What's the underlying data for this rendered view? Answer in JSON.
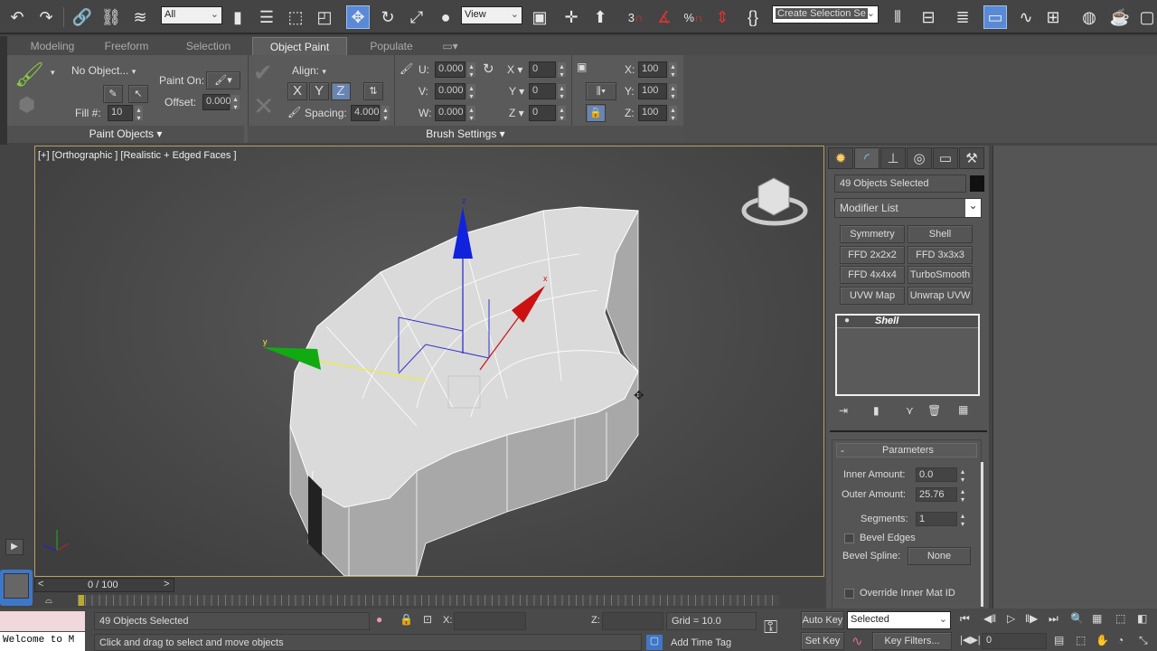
{
  "toolbar": {
    "selection_filter": "All",
    "reference_coord": "View",
    "named_selection_placeholder": "Create Selection Se",
    "snap_angle_label": "3",
    "percent_snap_label": "%"
  },
  "ribbon": {
    "tabs": [
      "Modeling",
      "Freeform",
      "Selection",
      "Object Paint",
      "Populate"
    ],
    "active_tab": "Object Paint",
    "paint_objects": {
      "object_dropdown": "No Object...",
      "fill_label": "Fill #:",
      "fill_value": "10",
      "paint_on_label": "Paint On:",
      "offset_label": "Offset:",
      "offset_value": "0.000",
      "footer": "Paint Objects"
    },
    "brush_settings": {
      "align_label": "Align:",
      "axes": [
        "X",
        "Y",
        "Z"
      ],
      "active_axis": "Z",
      "spacing_label": "Spacing:",
      "spacing_value": "4.000",
      "u_label": "U:",
      "u_value": "0.000",
      "v_label": "V:",
      "v_value": "0.000",
      "w_label": "W:",
      "w_value": "0.000",
      "rx_label": "X",
      "rx_value": "0",
      "ry_label": "Y",
      "ry_value": "0",
      "rz_label": "Z",
      "rz_value": "0",
      "sx_label": "X:",
      "sx_value": "100",
      "sy_label": "Y:",
      "sy_value": "100",
      "sz_label": "Z:",
      "sz_value": "100",
      "footer": "Brush Settings"
    }
  },
  "viewport": {
    "label": "[+] [Orthographic ] [Realistic + Edged Faces ]",
    "gizmo_axes": {
      "x": "x",
      "y": "y",
      "z": "z"
    },
    "colors": {
      "x_axis": "#cc1111",
      "y_axis": "#22bb22",
      "z_axis": "#1122dd",
      "border": "#b8a060"
    }
  },
  "command_panel": {
    "object_name": "49 Objects Selected",
    "modifier_list": "Modifier List",
    "modifier_buttons": [
      "Symmetry",
      "Shell",
      "FFD 2x2x2",
      "FFD 3x3x3",
      "FFD 4x4x4",
      "TurboSmooth",
      "UVW Map",
      "Unwrap UVW"
    ],
    "stack_item": "Shell",
    "parameters": {
      "title": "Parameters",
      "collapse": "-",
      "inner_amount_label": "Inner Amount:",
      "inner_amount": "0.0",
      "outer_amount_label": "Outer Amount:",
      "outer_amount": "25.76",
      "segments_label": "Segments:",
      "segments": "1",
      "bevel_edges_label": "Bevel Edges",
      "bevel_edges": false,
      "bevel_spline_label": "Bevel Spline:",
      "bevel_spline": "None",
      "override_inner_label": "Override Inner Mat ID",
      "override_inner": false
    }
  },
  "timeline": {
    "frame": "0 / 100",
    "prev": "<",
    "next": ">"
  },
  "status_bar": {
    "maxscript": "Welcome to M",
    "selection": "49 Objects Selected",
    "prompt": "Click and drag to select and move objects",
    "x_label": "X:",
    "z_label": "Z:",
    "grid": "Grid = 10.0",
    "add_time_tag": "Add Time Tag",
    "auto_key": "Auto Key",
    "set_key": "Set Key",
    "key_mode": "Selected",
    "key_filters": "Key Filters...",
    "current_frame": "0"
  }
}
